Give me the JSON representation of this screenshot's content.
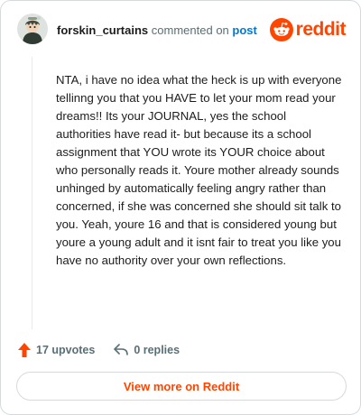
{
  "header": {
    "username": "forskin_curtains",
    "commented_text": "commented on",
    "post_link": "post",
    "brand_wordmark": "reddit"
  },
  "comment": {
    "text": "NTA, i have no idea what the heck is up with everyone tellinng you that you HAVE to let your mom read your dreams!! Its your JOURNAL, yes the school authorities have read it- but because its a school assignment that YOU wrote its YOUR choice about who personally reads it. Youre mother already sounds unhinged by automatically feeling angry rather than concerned, if she was concerned she should sit talk to you. Yeah, youre 16 and that is considered young but youre a young adult and it isnt fair to treat you like you have no authority over your own reflections."
  },
  "actions": {
    "upvotes_label": "17 upvotes",
    "replies_label": "0 replies"
  },
  "footer": {
    "view_more_label": "View more on Reddit"
  },
  "icons": {
    "avatar": "user-avatar-icon",
    "brand": "reddit-snoo-icon",
    "upvote": "upvote-arrow-icon",
    "reply": "reply-arrow-icon"
  },
  "colors": {
    "brand": "#ff4500",
    "link": "#0079d3",
    "muted": "#576f76",
    "border": "#d7dadc"
  }
}
